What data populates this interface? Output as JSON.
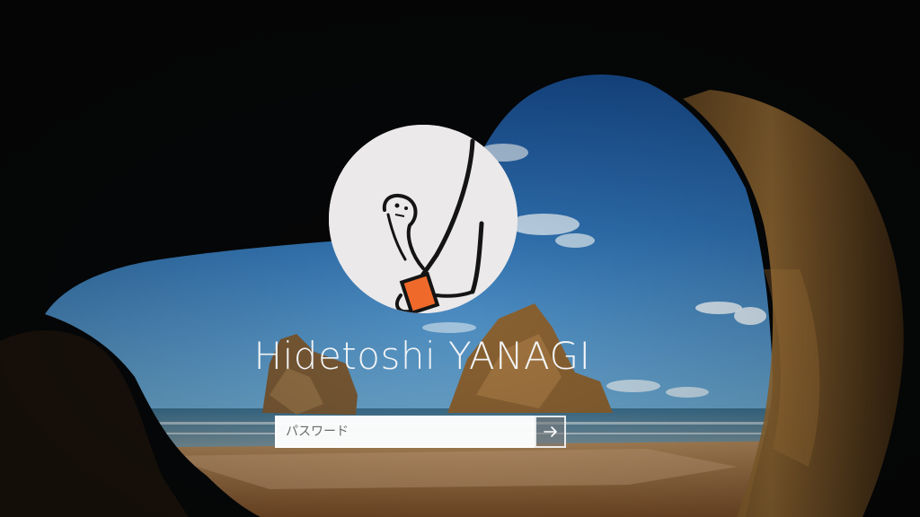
{
  "lock_screen": {
    "user_name": "Hidetoshi YANAGI",
    "password_placeholder": "パスワード",
    "submit_icon": "arrow-right-icon",
    "accent_color": "#ef6a2a"
  }
}
